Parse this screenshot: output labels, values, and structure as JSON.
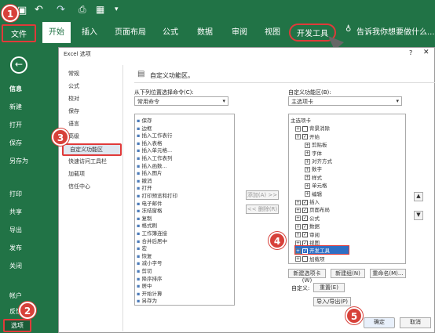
{
  "ribbon": {
    "tabs": [
      "文件",
      "开始",
      "插入",
      "页面布局",
      "公式",
      "数据",
      "审阅",
      "视图",
      "开发工具"
    ],
    "tell_me": "告诉我你想要做什么..."
  },
  "sidebar": {
    "items": [
      "信息",
      "新建",
      "打开",
      "保存",
      "另存为",
      "打印",
      "共享",
      "导出",
      "发布",
      "关闭",
      "帐户",
      "反馈",
      "选项"
    ]
  },
  "dialog": {
    "title": "Excel 选项",
    "heading": "自定义功能区。",
    "nav": [
      "常规",
      "公式",
      "校对",
      "保存",
      "语言",
      "高级",
      "自定义功能区",
      "快速访问工具栏",
      "加载项",
      "信任中心"
    ],
    "left_label": "从下列位置选择命令(C):",
    "left_combo": "常用命令",
    "right_label": "自定义功能区(B):",
    "right_combo": "主选项卡",
    "left_list": [
      "保存",
      "边框",
      "插入工作表行",
      "插入表格",
      "插入单元格...",
      "插入工作表列",
      "插入函数...",
      "插入图片",
      "撤消",
      "打开",
      "打印预览和打印",
      "电子邮件",
      "冻结窗格",
      "复制",
      "格式刷",
      "工作簿连接",
      "合并后居中",
      "宏",
      "恢复",
      "减小字号",
      "剪切",
      "降序排序",
      "居中",
      "开始计算",
      "另存为"
    ],
    "add_btn": "添加(A) >>",
    "remove_btn": "<< 删除(R)",
    "right_list": [
      "主选项卡",
      "背景消除",
      "开始",
      "剪贴板",
      "字体",
      "对齐方式",
      "数字",
      "样式",
      "单元格",
      "编辑",
      "插入",
      "页面布局",
      "公式",
      "数据",
      "审阅",
      "视图",
      "开发工具",
      "加载项"
    ],
    "new_tab": "新建选项卡(W)",
    "new_group": "新建组(N)",
    "rename": "重命名(M)...",
    "customize_label": "自定义:",
    "reset": "重置(E)",
    "import_export": "导入/导出(P)",
    "ok": "确定",
    "cancel": "取消"
  },
  "badges": [
    "1",
    "2",
    "3",
    "4",
    "5"
  ],
  "colors": {
    "accent": "#217346",
    "highlight": "#e03a3a"
  }
}
